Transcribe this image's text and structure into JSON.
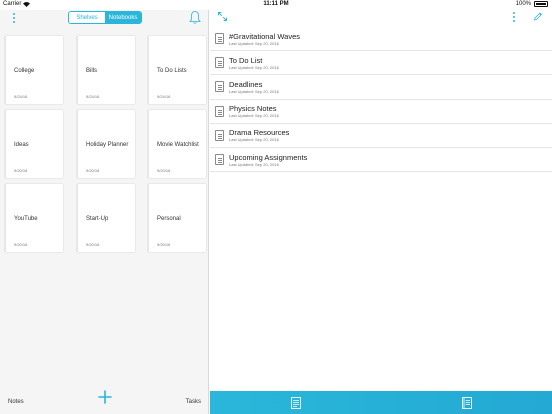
{
  "status": {
    "carrier": "Carrier",
    "time": "11:11 PM",
    "battery": "100%"
  },
  "colors": {
    "accent": "#29b6d8",
    "pane_bg": "#f5f5f5",
    "card_bg": "#ffffff"
  },
  "left_header": {
    "segments": [
      "Shelves",
      "Notebooks"
    ],
    "selected_segment": "Notebooks",
    "icons": [
      "more-vertical-icon",
      "bell-icon"
    ]
  },
  "notebooks": [
    {
      "title": "College",
      "date": "9/24/16"
    },
    {
      "title": "Bills",
      "date": "9/24/16"
    },
    {
      "title": "To Do Lists",
      "date": "9/24/16"
    },
    {
      "title": "Ideas",
      "date": "9/20/16"
    },
    {
      "title": "Holiday Planner",
      "date": "9/20/16"
    },
    {
      "title": "Movie Watchlist",
      "date": "9/20/16"
    },
    {
      "title": "YouTube",
      "date": "9/20/16"
    },
    {
      "title": "Start-Up",
      "date": "9/20/16"
    },
    {
      "title": "Personal",
      "date": "9/20/16"
    }
  ],
  "left_footer": {
    "notes_label": "Notes",
    "tasks_label": "Tasks"
  },
  "right_header": {
    "icons": [
      "expand-icon",
      "more-vertical-icon",
      "pencil-icon"
    ]
  },
  "notes": [
    {
      "title": "#Gravitational Waves",
      "updated": "Last Updated: Sep 20, 2016"
    },
    {
      "title": "To Do List",
      "updated": "Last Updated: Sep 20, 2016"
    },
    {
      "title": "Deadlines",
      "updated": "Last Updated: Sep 20, 2016"
    },
    {
      "title": "Physics Notes",
      "updated": "Last Updated: Sep 20, 2016"
    },
    {
      "title": "Drama Resources",
      "updated": "Last Updated: Sep 20, 2016"
    },
    {
      "title": "Upcoming Assignments",
      "updated": "Last Updated: Sep 20, 2016"
    }
  ],
  "tabbar": {
    "icons": [
      "note-icon",
      "notebook-icon"
    ]
  }
}
